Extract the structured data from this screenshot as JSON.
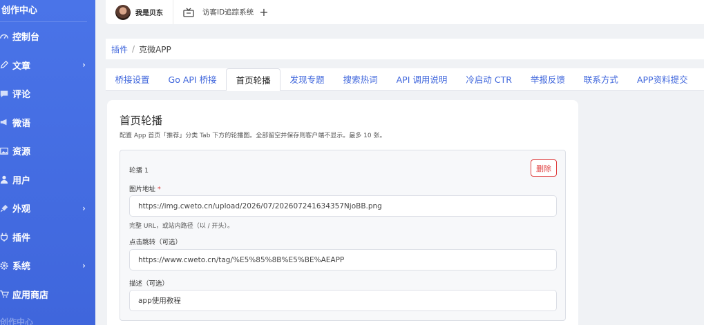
{
  "sidebar": {
    "brand": "创作中心",
    "items": [
      {
        "label": "控制台",
        "icon": "dashboard-icon",
        "has_children": false
      },
      {
        "label": "文章",
        "icon": "pen-icon",
        "has_children": true
      },
      {
        "label": "评论",
        "icon": "comment-icon",
        "has_children": false
      },
      {
        "label": "微语",
        "icon": "megaphone-icon",
        "has_children": false
      },
      {
        "label": "资源",
        "icon": "image-icon",
        "has_children": false
      },
      {
        "label": "用户",
        "icon": "user-icon",
        "has_children": false
      },
      {
        "label": "外观",
        "icon": "brush-icon",
        "has_children": true
      },
      {
        "label": "插件",
        "icon": "plug-icon",
        "has_children": false
      },
      {
        "label": "系统",
        "icon": "gear-icon",
        "has_children": true
      },
      {
        "label": "应用商店",
        "icon": "cart-icon",
        "has_children": false
      }
    ],
    "cut_off_label": "创作中心"
  },
  "topbar": {
    "user_name": "我是贝东",
    "open_tab": "访客ID追踪系统",
    "add_symbol": "+"
  },
  "breadcrumb": {
    "parent": "插件",
    "separator": "/",
    "current": "克微APP"
  },
  "tabs": [
    {
      "label": "桥接设置",
      "active": false
    },
    {
      "label": "Go API 桥接",
      "active": false
    },
    {
      "label": "首页轮播",
      "active": true
    },
    {
      "label": "发现专题",
      "active": false
    },
    {
      "label": "搜索热词",
      "active": false
    },
    {
      "label": "API 调用说明",
      "active": false
    },
    {
      "label": "冷启动 CTR",
      "active": false
    },
    {
      "label": "举报反馈",
      "active": false
    },
    {
      "label": "联系方式",
      "active": false
    },
    {
      "label": "APP资料提交",
      "active": false
    }
  ],
  "card": {
    "title": "首页轮播",
    "description": "配置 App 首页「推荐」分类 Tab 下方的轮播图。全部留空并保存则客户端不显示。最多 10 张。",
    "slide": {
      "label": "轮播 1",
      "delete_label": "删除",
      "image_label": "图片地址",
      "required_mark": "*",
      "image_value": "https://img.cweto.cn/upload/2026/07/202607241634357NjoBB.png",
      "image_hint": "完整 URL，或站内路径（以 / 开头）。",
      "link_label": "点击跳转（可选）",
      "link_value": "https://www.cweto.cn/tag/%E5%85%8B%E5%BE%AEAPP",
      "desc_label": "描述（可选）",
      "desc_value": "app使用教程"
    }
  },
  "colors": {
    "accent": "#3f66dc",
    "sidebar_bg": "#4a74e8",
    "danger": "#e04040"
  }
}
